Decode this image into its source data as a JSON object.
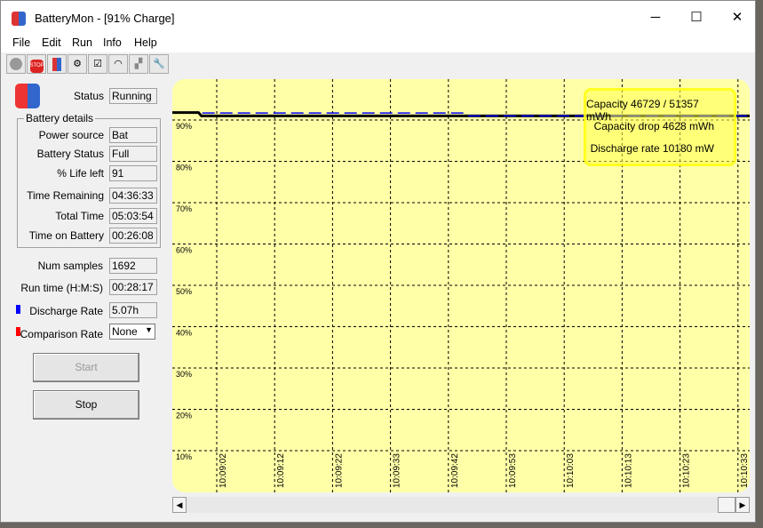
{
  "window": {
    "title": "BatteryMon - [91% Charge]",
    "minimize": "─",
    "maximize": "☐",
    "close": "✕"
  },
  "menu": [
    "File",
    "Edit",
    "Run",
    "Info",
    "Help"
  ],
  "toolbar": [
    "record-icon",
    "stop-icon",
    "battery-icon",
    "settings-info-icon",
    "checklist-icon",
    "gauge-icon",
    "puzzle-icon",
    "tools-icon"
  ],
  "panel": {
    "status_label": "Status",
    "status": "Running",
    "group_title": "Battery details",
    "details": [
      {
        "label": "Power source",
        "value": "Bat"
      },
      {
        "label": "Battery Status",
        "value": "Full"
      },
      {
        "label": "% Life left",
        "value": "91"
      },
      {
        "label": "Time Remaining",
        "value": "04:36:33"
      },
      {
        "label": "Total Time",
        "value": "05:03:54"
      },
      {
        "label": "Time on Battery",
        "value": "00:26:08"
      }
    ],
    "num_samples_label": "Num samples",
    "num_samples": "1692",
    "run_time_label": "Run time (H:M:S)",
    "run_time": "00:28:17",
    "discharge_label": "Discharge Rate",
    "discharge": "5.07h",
    "discharge_color": "#0000ff",
    "comparison_label": "Comparison Rate",
    "comparison": "None",
    "comparison_color": "#ff0000",
    "start": "Start",
    "stop": "Stop"
  },
  "chart_data": {
    "type": "line",
    "yticks": [
      "90%",
      "80%",
      "70%",
      "60%",
      "50%",
      "40%",
      "30%",
      "20%",
      "10%"
    ],
    "ytick_values": [
      90,
      80,
      70,
      60,
      50,
      40,
      30,
      20,
      10
    ],
    "xticks": [
      "10:09:02",
      "10:09:12",
      "10:09:22",
      "10:09:33",
      "10:09:42",
      "10:09:53",
      "10:10:03",
      "10:10:13",
      "10:10:23",
      "10:10:33"
    ],
    "grid": true,
    "series": [
      {
        "color": "#000000",
        "style": "solid",
        "points": [
          [
            0,
            91.8
          ],
          [
            0.45,
            91.8
          ],
          [
            0.5,
            91
          ],
          [
            10,
            91
          ]
        ]
      },
      {
        "color": "#0000ff",
        "style": "dashed",
        "points": [
          [
            0.5,
            91.7
          ],
          [
            5,
            91.7
          ],
          [
            5.1,
            91
          ],
          [
            10,
            91
          ]
        ]
      }
    ],
    "legend": {
      "capacity": "Capacity 46729 / 51357 mWh",
      "drop": "Capacity drop 4628 mWh",
      "rate": "Discharge rate 10180 mW",
      "placement": "top-right",
      "color": "#ffff50"
    }
  }
}
